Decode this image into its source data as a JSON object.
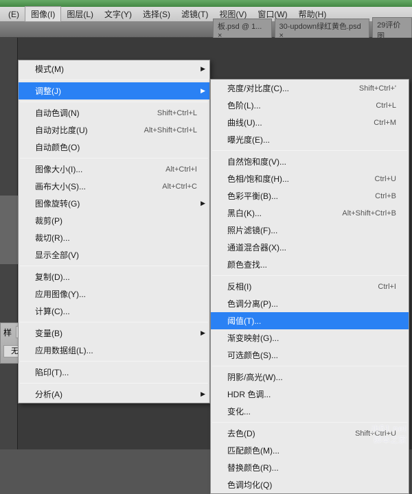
{
  "menubar": {
    "items": [
      "(E)",
      "图像(I)",
      "图层(L)",
      "文字(Y)",
      "选择(S)",
      "滤镜(T)",
      "视图(V)",
      "窗口(W)",
      "帮助(H)"
    ],
    "active_index": 1
  },
  "tabs": [
    {
      "label": "板.psd @ 1... ×"
    },
    {
      "label": "30-updown绿红黄色.psd ×"
    },
    {
      "label": "29评价图"
    }
  ],
  "menu1": [
    {
      "t": "item",
      "label": "模式(M)",
      "sub": true
    },
    {
      "t": "sep"
    },
    {
      "t": "item",
      "label": "调整(J)",
      "sub": true,
      "sel": true
    },
    {
      "t": "sep"
    },
    {
      "t": "item",
      "label": "自动色调(N)",
      "sc": "Shift+Ctrl+L"
    },
    {
      "t": "item",
      "label": "自动对比度(U)",
      "sc": "Alt+Shift+Ctrl+L"
    },
    {
      "t": "item",
      "label": "自动颜色(O)"
    },
    {
      "t": "sep"
    },
    {
      "t": "item",
      "label": "图像大小(I)...",
      "sc": "Alt+Ctrl+I"
    },
    {
      "t": "item",
      "label": "画布大小(S)...",
      "sc": "Alt+Ctrl+C"
    },
    {
      "t": "item",
      "label": "图像旋转(G)",
      "sub": true
    },
    {
      "t": "item",
      "label": "裁剪(P)"
    },
    {
      "t": "item",
      "label": "裁切(R)..."
    },
    {
      "t": "item",
      "label": "显示全部(V)"
    },
    {
      "t": "sep"
    },
    {
      "t": "item",
      "label": "复制(D)..."
    },
    {
      "t": "item",
      "label": "应用图像(Y)..."
    },
    {
      "t": "item",
      "label": "计算(C)..."
    },
    {
      "t": "sep"
    },
    {
      "t": "item",
      "label": "变量(B)",
      "sub": true
    },
    {
      "t": "item",
      "label": "应用数据组(L)..."
    },
    {
      "t": "sep"
    },
    {
      "t": "item",
      "label": "陷印(T)..."
    },
    {
      "t": "sep"
    },
    {
      "t": "item",
      "label": "分析(A)",
      "sub": true
    }
  ],
  "menu2": [
    {
      "t": "item",
      "label": "亮度/对比度(C)...",
      "sc": "Shift+Ctrl+'"
    },
    {
      "t": "item",
      "label": "色阶(L)...",
      "sc": "Ctrl+L"
    },
    {
      "t": "item",
      "label": "曲线(U)...",
      "sc": "Ctrl+M"
    },
    {
      "t": "item",
      "label": "曝光度(E)..."
    },
    {
      "t": "sep"
    },
    {
      "t": "item",
      "label": "自然饱和度(V)..."
    },
    {
      "t": "item",
      "label": "色相/饱和度(H)...",
      "sc": "Ctrl+U"
    },
    {
      "t": "item",
      "label": "色彩平衡(B)...",
      "sc": "Ctrl+B"
    },
    {
      "t": "item",
      "label": "黑白(K)...",
      "sc": "Alt+Shift+Ctrl+B"
    },
    {
      "t": "item",
      "label": "照片滤镜(F)..."
    },
    {
      "t": "item",
      "label": "通道混合器(X)..."
    },
    {
      "t": "item",
      "label": "颜色查找..."
    },
    {
      "t": "sep"
    },
    {
      "t": "item",
      "label": "反相(I)",
      "sc": "Ctrl+I"
    },
    {
      "t": "item",
      "label": "色调分离(P)..."
    },
    {
      "t": "item",
      "label": "阈值(T)...",
      "sel": true
    },
    {
      "t": "item",
      "label": "渐变映射(G)..."
    },
    {
      "t": "item",
      "label": "可选颜色(S)..."
    },
    {
      "t": "sep"
    },
    {
      "t": "item",
      "label": "阴影/高光(W)..."
    },
    {
      "t": "item",
      "label": "HDR 色调..."
    },
    {
      "t": "item",
      "label": "变化..."
    },
    {
      "t": "sep"
    },
    {
      "t": "item",
      "label": "去色(D)",
      "sc": "Shift+Ctrl+U"
    },
    {
      "t": "item",
      "label": "匹配颜色(M)..."
    },
    {
      "t": "item",
      "label": "替换颜色(R)..."
    },
    {
      "t": "item",
      "label": "色调均化(Q)"
    }
  ],
  "props": {
    "label": "样",
    "value": "无"
  },
  "watermark": {
    "url": "jb51.net",
    "text": "脚本之家"
  }
}
